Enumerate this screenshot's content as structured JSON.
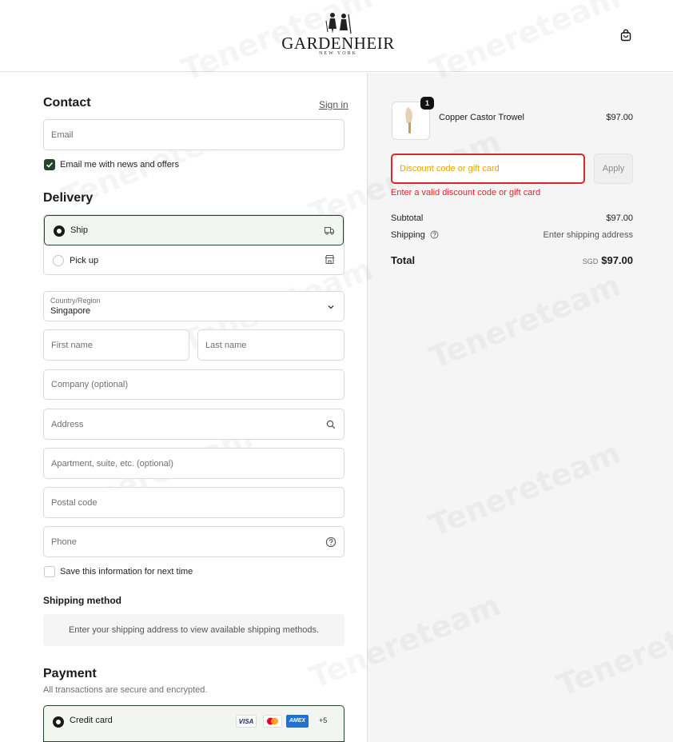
{
  "brand": {
    "name": "GARDENHEIR",
    "subtitle": "NEW YORK"
  },
  "contact": {
    "heading": "Contact",
    "sign_in": "Sign in",
    "email_placeholder": "Email",
    "newsletter_label": "Email me with news and offers",
    "newsletter_checked": true
  },
  "delivery": {
    "heading": "Delivery",
    "options": [
      {
        "label": "Ship",
        "selected": true,
        "icon": "truck-icon"
      },
      {
        "label": "Pick up",
        "selected": false,
        "icon": "store-icon"
      }
    ],
    "country_label": "Country/Region",
    "country_value": "Singapore",
    "first_name": "First name",
    "last_name": "Last name",
    "company": "Company (optional)",
    "address": "Address",
    "apartment": "Apartment, suite, etc. (optional)",
    "postal": "Postal code",
    "phone": "Phone",
    "save_info": "Save this information for next time"
  },
  "shipping_method": {
    "heading": "Shipping method",
    "message": "Enter your shipping address to view available shipping methods."
  },
  "payment": {
    "heading": "Payment",
    "subtitle": "All transactions are secure and encrypted.",
    "method": "Credit card",
    "card_logos": [
      "VISA",
      "AMEX"
    ],
    "more": "+5"
  },
  "summary": {
    "item": {
      "name": "Copper Castor Trowel",
      "price": "$97.00",
      "quantity": "1"
    },
    "discount_placeholder": "Discount code or gift card",
    "apply": "Apply",
    "error": "Enter a valid discount code or gift card",
    "subtotal_label": "Subtotal",
    "subtotal_value": "$97.00",
    "shipping_label": "Shipping",
    "shipping_value": "Enter shipping address",
    "total_label": "Total",
    "currency": "SGD",
    "total_value": "$97.00"
  },
  "watermark": "Tenereteam",
  "colors": {
    "accent_green": "#24452c",
    "error_red": "#d42a2a",
    "discount_text": "#e0a800"
  }
}
